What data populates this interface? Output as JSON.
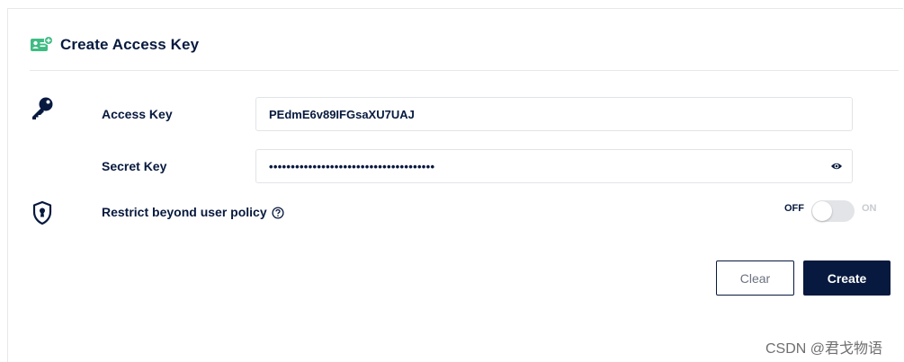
{
  "header": {
    "title": "Create Access Key",
    "icon": "id-card-add-icon",
    "icon_color": "#3ebc83"
  },
  "access_key": {
    "label": "Access Key",
    "value": "PEdmE6v89IFGsaXU7UAJ",
    "icon": "key-icon"
  },
  "secret_key": {
    "label": "Secret Key",
    "masked_value": "••••••••••••••••••••••••••••••••••••••",
    "toggle_visibility_icon": "eye-icon"
  },
  "policy": {
    "label": "Restrict beyond user policy",
    "icon": "shield-keyhole-icon",
    "help_icon": "question-circle-icon",
    "toggle_off_label": "OFF",
    "toggle_on_label": "ON",
    "enabled": false
  },
  "actions": {
    "clear_label": "Clear",
    "create_label": "Create"
  },
  "watermark": "CSDN @君戈物语",
  "colors": {
    "primary": "#07193e",
    "accent": "#3ebc83",
    "border": "#e1e4e8"
  }
}
